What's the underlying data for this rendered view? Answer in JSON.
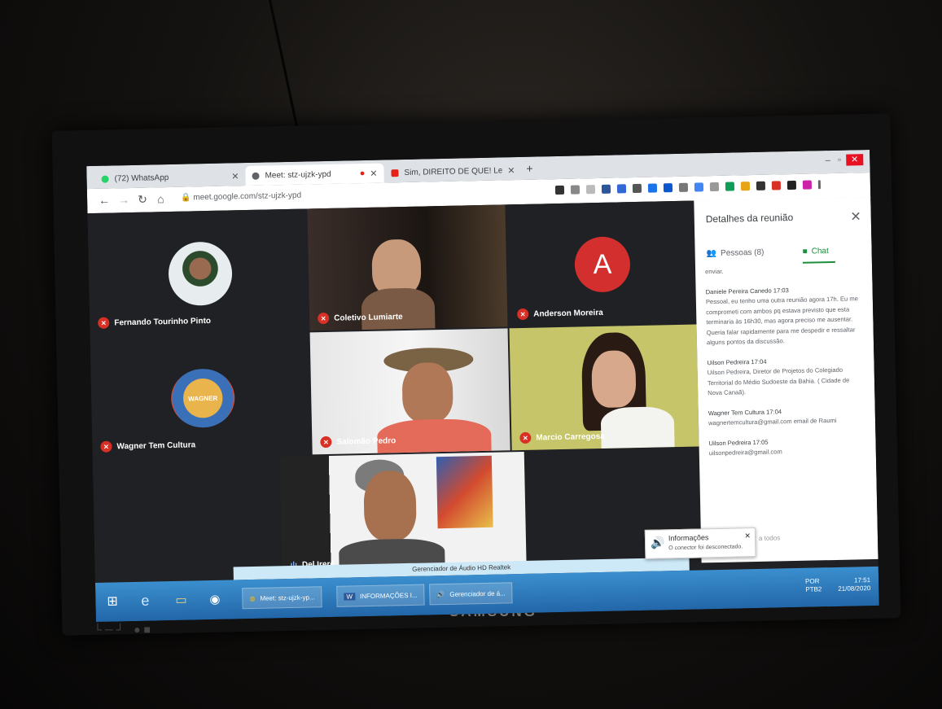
{
  "browser": {
    "tabs": [
      {
        "label": "(72) WhatsApp",
        "color": "#25d366"
      },
      {
        "label": "Meet: stz-ujzk-ypd",
        "color": "#5f6368"
      },
      {
        "label": "Sim, DIREITO DE QUE! Lei Aldir B",
        "color": "#e62117"
      }
    ],
    "url": "meet.google.com/stz-ujzk-ypd"
  },
  "participants": [
    {
      "name": "Fernando Tourinho Pinto"
    },
    {
      "name": "Coletivo Lumiarte"
    },
    {
      "name": "Anderson Moreira",
      "initial": "A"
    },
    {
      "name": "Wagner Tem Cultura",
      "logo_text": "WAGNER"
    },
    {
      "name": "Salomão Pedro"
    },
    {
      "name": "Marcio Carregosa"
    },
    {
      "name": "Del Irerê"
    }
  ],
  "panel": {
    "title": "Detalhes da reunião",
    "people_tab": "Pessoas (8)",
    "chat_tab": "Chat",
    "messages": [
      {
        "sender": "",
        "text": "enviar."
      },
      {
        "sender": "Daniele Pereira Canedo",
        "time": "17:03",
        "text": "Pessoal, eu tenho uma outra reunião agora 17h. Eu me comprometi com ambos pq estava previsto que esta terminaria às 16h30, mas agora preciso me ausentar. Queria falar rapidamente para me despedir e ressaltar alguns pontos da discussão."
      },
      {
        "sender": "Uilson Pedreira",
        "time": "17:04",
        "text": "Uilson Pedreira, Diretor de Projetos do Colegiado Territorial do Médio Sudoeste da Bahia. ( Cidade de Nova Canaã)."
      },
      {
        "sender": "Wagner Tem Cultura",
        "time": "17:04",
        "text": "wagnertemcultura@gmail.com email de Raumi"
      },
      {
        "sender": "Uilson Pedreira",
        "time": "17:05",
        "text": "uilsonpedreira@gmail.com"
      }
    ]
  },
  "notification": {
    "title": "Informações",
    "body": "O conector foi desconectado.",
    "extra": "a todos"
  },
  "dialog": {
    "text": "Gerenciador de Áudio HD Realtek"
  },
  "taskbar": {
    "items": [
      "Meet: stz-ujzk-yp...",
      "INFORMAÇÕES I...",
      "Gerenciador de á..."
    ],
    "lang_top": "POR",
    "lang_bottom": "PTB2",
    "time": "17:51",
    "date": "21/08/2020"
  },
  "monitor": {
    "brand": "SAMSUNG"
  },
  "colors": {
    "meet_bg": "#202124",
    "mic_off": "#d93025",
    "chat_accent": "#1e8e3e",
    "taskbar": "#2a76b8"
  }
}
